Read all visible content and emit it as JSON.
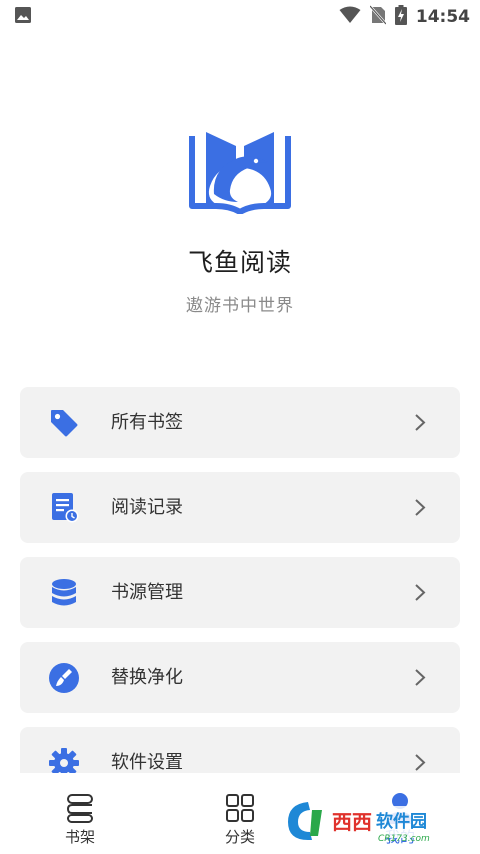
{
  "status_bar": {
    "time": "14:54",
    "icons": [
      "image-notification-icon",
      "wifi-icon",
      "no-sim-icon",
      "battery-charging-icon"
    ]
  },
  "brand": {
    "app_name": "飞鱼阅读",
    "slogan": "遨游书中世界",
    "logo_icon": "open-book-fish-logo",
    "accent_color": "#3b6fe3"
  },
  "menu": {
    "items": [
      {
        "label": "所有书签",
        "icon": "tag-icon"
      },
      {
        "label": "阅读记录",
        "icon": "document-clock-icon"
      },
      {
        "label": "书源管理",
        "icon": "database-icon"
      },
      {
        "label": "替换净化",
        "icon": "brush-circle-icon"
      },
      {
        "label": "软件设置",
        "icon": "gear-icon"
      }
    ]
  },
  "bottom_nav": {
    "items": [
      {
        "label": "书架",
        "icon": "bookshelf-icon"
      },
      {
        "label": "分类",
        "icon": "grid-icon"
      },
      {
        "label": "我的",
        "icon": "person-icon",
        "active": true
      }
    ]
  },
  "watermark": {
    "text": "西西软件园",
    "sub": "CR173.com"
  }
}
